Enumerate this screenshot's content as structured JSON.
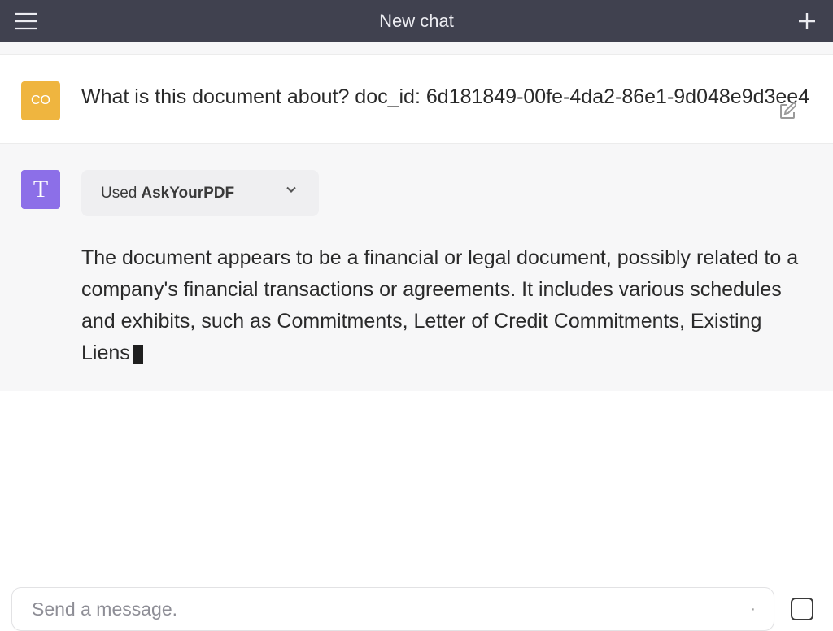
{
  "header": {
    "title": "New chat"
  },
  "user": {
    "avatar_text": "CO",
    "message": "What is this document about? doc_id: 6d181849-00fe-4da2-86e1-9d048e9d3ee4"
  },
  "assistant": {
    "avatar_text": "T",
    "plugin_used_prefix": "Used",
    "plugin_used_name": "AskYourPDF",
    "response": "The document appears to be a financial or legal document, possibly related to a company's financial transactions or agreements. It includes various schedules and exhibits, such as Commitments, Letter of Credit Commitments, Existing Liens"
  },
  "composer": {
    "placeholder": "Send a message."
  },
  "colors": {
    "header_bg": "#40414f",
    "user_avatar": "#efb53f",
    "assistant_avatar": "#8c6fe8",
    "assistant_bg": "#f7f7f8"
  }
}
